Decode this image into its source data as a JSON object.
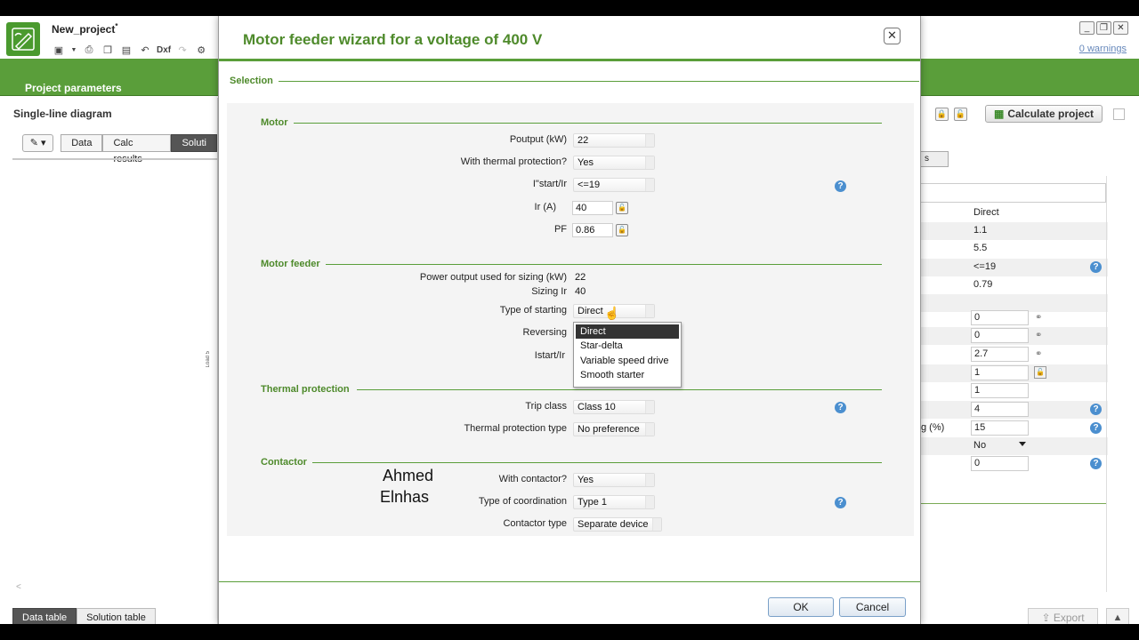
{
  "app": {
    "project_name": "New_project",
    "modified_marker": "*",
    "toolbar_dxf": "Dxf",
    "warnings_link": "0 warnings",
    "project_parameters_tab": "Project parameters",
    "win_minimize": "_",
    "win_restore": "❐",
    "win_close": "✕"
  },
  "left_panel": {
    "title": "Single-line diagram",
    "tabs": [
      "Data",
      "Calc results",
      "Soluti"
    ],
    "bottom_tabs": [
      "Data table",
      "Solution table"
    ],
    "scroll_label": "Load 5",
    "scroll_arrow": "<"
  },
  "right_panel": {
    "calculate_button": "Calculate project",
    "stub_button": "s",
    "values": [
      "Direct",
      "1.1",
      "5.5",
      "<=19",
      "0.79"
    ],
    "inputs": [
      "0",
      "0",
      "2.7",
      "1",
      "1",
      "4",
      "15"
    ],
    "label_fragment": "g (%)",
    "dropdown_value": "No",
    "last_input": "0",
    "export_button": "Export",
    "up_arrow": "▲"
  },
  "dialog": {
    "title": "Motor feeder wizard for a voltage of 400 V",
    "close_label": "✕",
    "selection_legend": "Selection",
    "motor": {
      "legend": "Motor",
      "poutput_label": "Poutput (kW)",
      "poutput_value": "22",
      "thermal_label": "With thermal protection?",
      "thermal_value": "Yes",
      "istart_label": "I\"start/Ir",
      "istart_value": "<=19",
      "ir_label": "Ir (A)",
      "ir_value": "40",
      "pf_label": "PF",
      "pf_value": "0.86"
    },
    "motor_feeder": {
      "legend": "Motor feeder",
      "power_sizing_label": "Power output used for sizing (kW)",
      "power_sizing_value": "22",
      "sizing_ir_label": "Sizing Ir",
      "sizing_ir_value": "40",
      "starting_label": "Type of starting",
      "starting_value": "Direct",
      "reversing_label": "Reversing",
      "istart_ir_label": "Istart/Ir",
      "starting_options": [
        "Direct",
        "Star-delta",
        "Variable speed drive",
        "Smooth starter"
      ]
    },
    "thermal_protection": {
      "legend": "Thermal protection",
      "trip_label": "Trip class",
      "trip_value": "Class 10",
      "type_label": "Thermal protection type",
      "type_value": "No preference"
    },
    "contactor": {
      "legend": "Contactor",
      "with_label": "With contactor?",
      "with_value": "Yes",
      "coord_label": "Type of coordination",
      "coord_value": "Type 1",
      "type_label": "Contactor type",
      "type_value": "Separate device"
    },
    "watermark_line1": "Ahmed",
    "watermark_line2": "Elnhas",
    "ok_button": "OK",
    "cancel_button": "Cancel",
    "help_glyph": "?"
  }
}
